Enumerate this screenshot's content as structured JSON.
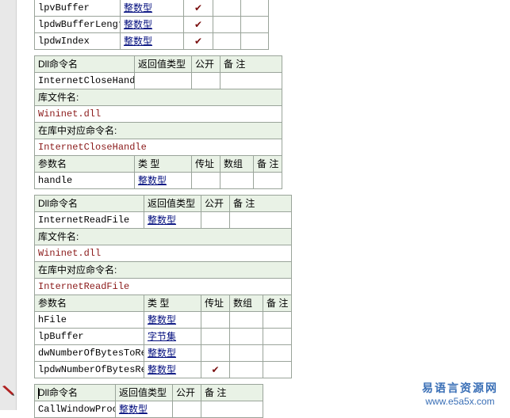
{
  "labels": {
    "dll_cmd": "Dll命令名",
    "ret_type": "返回值类型",
    "public": "公开",
    "note": "备 注",
    "lib_file": "库文件名:",
    "lib_cmd": "在库中对应命令名:",
    "param_name": "参数名",
    "type": "类 型",
    "byref": "传址",
    "array": "数组"
  },
  "check_glyph": "✔",
  "top_params": [
    {
      "name": "lpvBuffer",
      "type": "整数型",
      "byref": true
    },
    {
      "name": "lpdwBufferLength",
      "type": "整数型",
      "byref": true
    },
    {
      "name": "lpdwIndex",
      "type": "整数型",
      "byref": true
    }
  ],
  "cmd1": {
    "name": "InternetCloseHandle",
    "ret_type": "",
    "lib": "Wininet.dll",
    "lib_cmd": "InternetCloseHandle",
    "params": [
      {
        "name": "handle",
        "type": "整数型",
        "byref": false
      }
    ]
  },
  "cmd2": {
    "name": "InternetReadFile",
    "ret_type": "整数型",
    "lib": "Wininet.dll",
    "lib_cmd": "InternetReadFile",
    "params": [
      {
        "name": "hFile",
        "type": "整数型",
        "byref": false
      },
      {
        "name": "lpBuffer",
        "type": "字节集",
        "byref": false
      },
      {
        "name": "dwNumberOfBytesToRead",
        "type": "整数型",
        "byref": false
      },
      {
        "name": "lpdwNumberOfBytesRead",
        "type": "整数型",
        "byref": true
      }
    ]
  },
  "cmd3": {
    "name": "CallWindowProcA",
    "ret_type": "整数型"
  },
  "watermark": {
    "title": "易语言资源网",
    "url": "www.e5a5x.com"
  },
  "colors": {
    "header_bg": "#e9f2e6",
    "border": "#9aa49a",
    "type_link": "#000c7d",
    "lib_text": "#8b1a1a",
    "watermark": "#3a6fb6"
  }
}
